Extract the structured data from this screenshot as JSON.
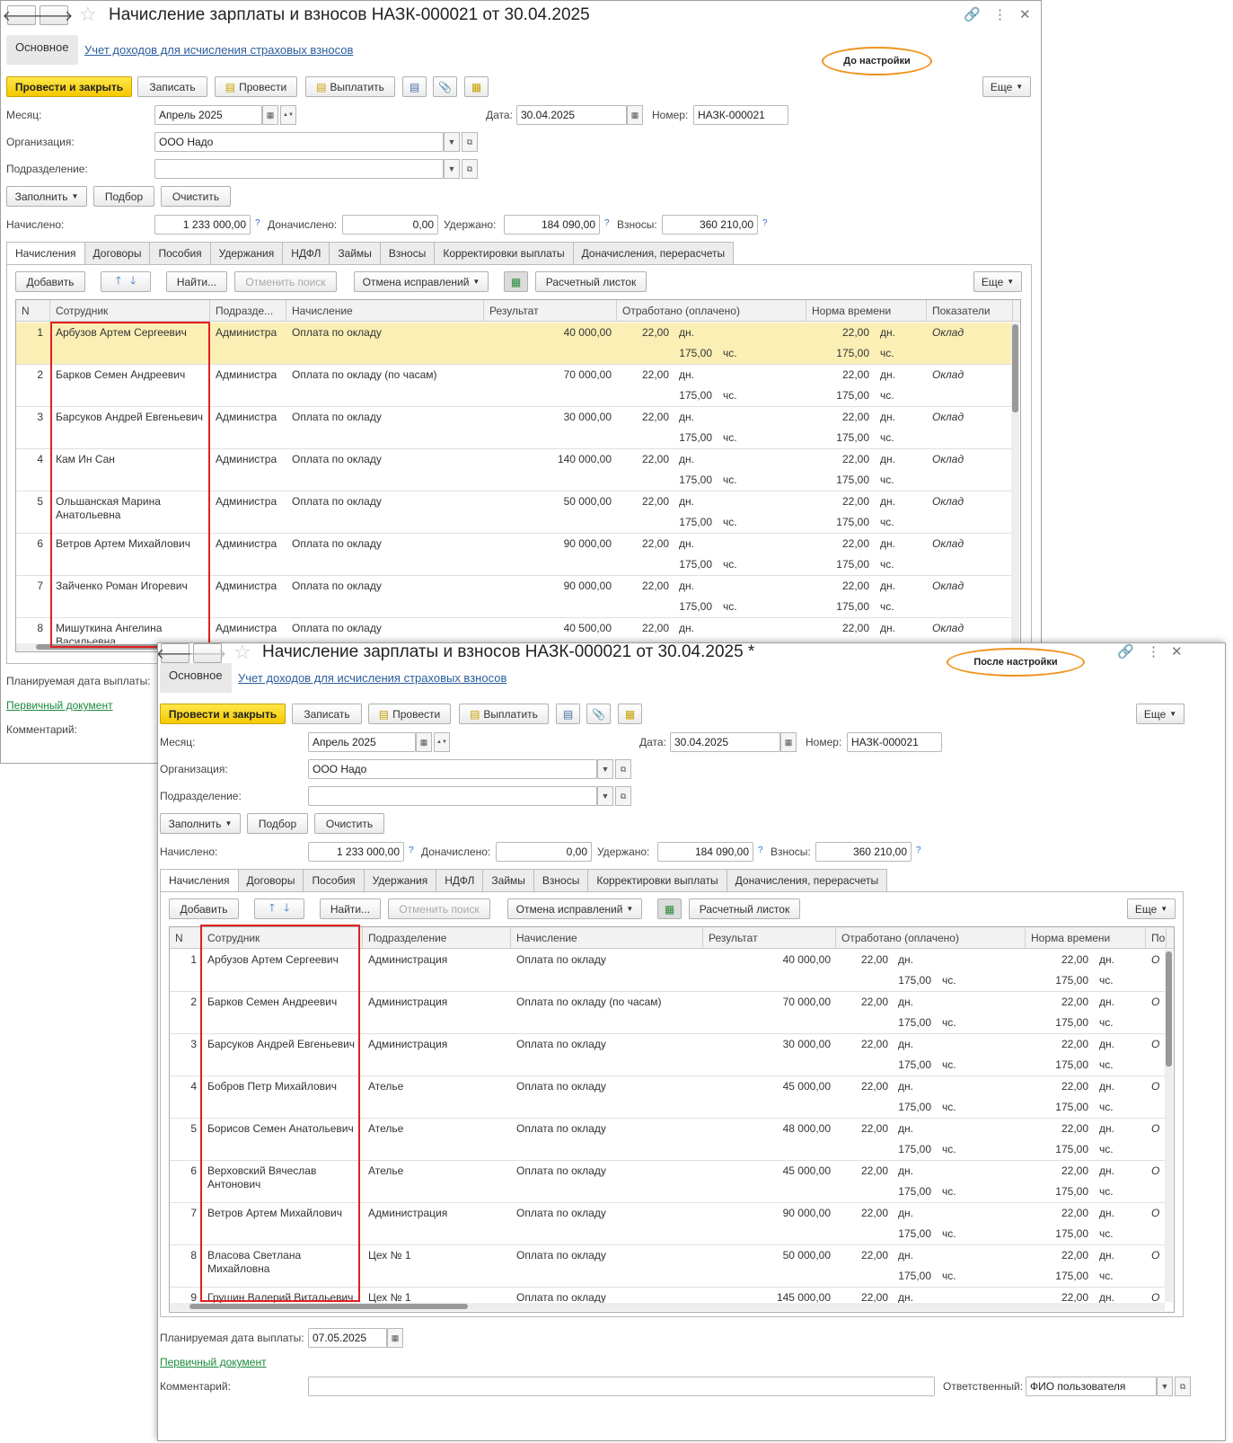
{
  "before": {
    "title": "Начисление зарплаты и взносов НАЗК-000021 от 30.04.2025",
    "nav_back": "🡐",
    "nav_fwd": "🡒",
    "tab_main": "Основное",
    "tab_link": "Учет доходов для исчисления страховых взносов",
    "annotation": "До настройки",
    "toolbar": {
      "post_close": "Провести и закрыть",
      "save": "Записать",
      "post": "Провести",
      "pay": "Выплатить",
      "more": "Еще"
    },
    "month_label": "Месяц:",
    "month_value": "Апрель 2025",
    "date_label": "Дата:",
    "date_value": "30.04.2025",
    "number_label": "Номер:",
    "number_value": "НАЗК-000021",
    "org_label": "Организация:",
    "org_value": "ООО Надо",
    "dept_label": "Подразделение:",
    "dept_value": "",
    "fill": "Заполнить",
    "pick": "Подбор",
    "clear": "Очистить",
    "accrued_label": "Начислено:",
    "accrued_value": "1 233 000,00",
    "extra_label": "Доначислено:",
    "extra_value": "0,00",
    "withheld_label": "Удержано:",
    "withheld_value": "184 090,00",
    "contrib_label": "Взносы:",
    "contrib_value": "360 210,00",
    "q": "?",
    "tabs": [
      "Начисления",
      "Договоры",
      "Пособия",
      "Удержания",
      "НДФЛ",
      "Займы",
      "Взносы",
      "Корректировки выплаты",
      "Доначисления, перерасчеты"
    ],
    "grid_toolbar": {
      "add": "Добавить",
      "find": "Найти...",
      "cancel_find": "Отменить поиск",
      "undo_fix": "Отмена исправлений",
      "payslip": "Расчетный листок",
      "more": "Еще"
    },
    "columns": [
      "N",
      "Сотрудник",
      "Подразде...",
      "Начисление",
      "Результат",
      "Отработано (оплачено)",
      "Норма времени",
      "Показатели"
    ],
    "rows": [
      {
        "n": "1",
        "emp": "Арбузов Артем Сергеевич",
        "dept": "Администра",
        "accr": "Оплата по окладу",
        "res": "40 000,00",
        "d": "22,00",
        "du": "дн.",
        "h": "175,00",
        "hu": "чс.",
        "nd": "22,00",
        "ndu": "дн.",
        "nh": "175,00",
        "nhu": "чс.",
        "ind": "Оклад"
      },
      {
        "n": "2",
        "emp": "Барков Семен Андреевич",
        "dept": "Администра",
        "accr": "Оплата по окладу (по часам)",
        "res": "70 000,00",
        "d": "22,00",
        "du": "дн.",
        "h": "175,00",
        "hu": "чс.",
        "nd": "22,00",
        "ndu": "дн.",
        "nh": "175,00",
        "nhu": "чс.",
        "ind": "Оклад"
      },
      {
        "n": "3",
        "emp": "Барсуков Андрей Евгеньевич",
        "dept": "Администра",
        "accr": "Оплата по окладу",
        "res": "30 000,00",
        "d": "22,00",
        "du": "дн.",
        "h": "175,00",
        "hu": "чс.",
        "nd": "22,00",
        "ndu": "дн.",
        "nh": "175,00",
        "nhu": "чс.",
        "ind": "Оклад"
      },
      {
        "n": "4",
        "emp": "Кам Ин Сан",
        "dept": "Администра",
        "accr": "Оплата по окладу",
        "res": "140 000,00",
        "d": "22,00",
        "du": "дн.",
        "h": "175,00",
        "hu": "чс.",
        "nd": "22,00",
        "ndu": "дн.",
        "nh": "175,00",
        "nhu": "чс.",
        "ind": "Оклад"
      },
      {
        "n": "5",
        "emp": "Ольшанская Марина Анатольевна",
        "dept": "Администра",
        "accr": "Оплата по окладу",
        "res": "50 000,00",
        "d": "22,00",
        "du": "дн.",
        "h": "175,00",
        "hu": "чс.",
        "nd": "22,00",
        "ndu": "дн.",
        "nh": "175,00",
        "nhu": "чс.",
        "ind": "Оклад"
      },
      {
        "n": "6",
        "emp": "Ветров Артем Михайлович",
        "dept": "Администра",
        "accr": "Оплата по окладу",
        "res": "90 000,00",
        "d": "22,00",
        "du": "дн.",
        "h": "175,00",
        "hu": "чс.",
        "nd": "22,00",
        "ndu": "дн.",
        "nh": "175,00",
        "nhu": "чс.",
        "ind": "Оклад"
      },
      {
        "n": "7",
        "emp": "Зайченко Роман Игоревич",
        "dept": "Администра",
        "accr": "Оплата по окладу",
        "res": "90 000,00",
        "d": "22,00",
        "du": "дн.",
        "h": "175,00",
        "hu": "чс.",
        "nd": "22,00",
        "ndu": "дн.",
        "nh": "175,00",
        "nhu": "чс.",
        "ind": "Оклад"
      },
      {
        "n": "8",
        "emp": "Мишуткина Ангелина Васильевна",
        "dept": "Администра",
        "accr": "Оплата по окладу",
        "res": "40 500,00",
        "d": "22,00",
        "du": "дн.",
        "h": "",
        "hu": "",
        "nd": "22,00",
        "ndu": "дн.",
        "nh": "",
        "nhu": "",
        "ind": "Оклад"
      }
    ],
    "planned_label": "Планируемая дата выплаты:",
    "primary_doc": "Первичный документ",
    "comment_label": "Комментарий:"
  },
  "after": {
    "title": "Начисление зарплаты и взносов НАЗК-000021 от 30.04.2025 *",
    "nav_back": "🡐",
    "nav_fwd": "🡒",
    "tab_main": "Основное",
    "tab_link": "Учет доходов для исчисления страховых взносов",
    "annotation": "После настройки",
    "toolbar": {
      "post_close": "Провести и закрыть",
      "save": "Записать",
      "post": "Провести",
      "pay": "Выплатить",
      "more": "Еще"
    },
    "month_label": "Месяц:",
    "month_value": "Апрель 2025",
    "date_label": "Дата:",
    "date_value": "30.04.2025",
    "number_label": "Номер:",
    "number_value": "НАЗК-000021",
    "org_label": "Организация:",
    "org_value": "ООО Надо",
    "dept_label": "Подразделение:",
    "dept_value": "",
    "fill": "Заполнить",
    "pick": "Подбор",
    "clear": "Очистить",
    "accrued_label": "Начислено:",
    "accrued_value": "1 233 000,00",
    "extra_label": "Доначислено:",
    "extra_value": "0,00",
    "withheld_label": "Удержано:",
    "withheld_value": "184 090,00",
    "contrib_label": "Взносы:",
    "contrib_value": "360 210,00",
    "q": "?",
    "tabs": [
      "Начисления",
      "Договоры",
      "Пособия",
      "Удержания",
      "НДФЛ",
      "Займы",
      "Взносы",
      "Корректировки выплаты",
      "Доначисления, перерасчеты"
    ],
    "grid_toolbar": {
      "add": "Добавить",
      "find": "Найти...",
      "cancel_find": "Отменить поиск",
      "undo_fix": "Отмена исправлений",
      "payslip": "Расчетный листок",
      "more": "Еще"
    },
    "columns": [
      "N",
      "Сотрудник",
      "Подразделение",
      "Начисление",
      "Результат",
      "Отработано (оплачено)",
      "Норма времени",
      "По"
    ],
    "rows": [
      {
        "n": "1",
        "emp": "Арбузов Артем Сергеевич",
        "dept": "Администрация",
        "accr": "Оплата по окладу",
        "res": "40 000,00",
        "d": "22,00",
        "du": "дн.",
        "h": "175,00",
        "hu": "чс.",
        "nd": "22,00",
        "ndu": "дн.",
        "nh": "175,00",
        "nhu": "чс.",
        "ind": "О"
      },
      {
        "n": "2",
        "emp": "Барков Семен Андреевич",
        "dept": "Администрация",
        "accr": "Оплата по окладу (по часам)",
        "res": "70 000,00",
        "d": "22,00",
        "du": "дн.",
        "h": "175,00",
        "hu": "чс.",
        "nd": "22,00",
        "ndu": "дн.",
        "nh": "175,00",
        "nhu": "чс.",
        "ind": "О"
      },
      {
        "n": "3",
        "emp": "Барсуков Андрей Евгеньевич",
        "dept": "Администрация",
        "accr": "Оплата по окладу",
        "res": "30 000,00",
        "d": "22,00",
        "du": "дн.",
        "h": "175,00",
        "hu": "чс.",
        "nd": "22,00",
        "ndu": "дн.",
        "nh": "175,00",
        "nhu": "чс.",
        "ind": "О"
      },
      {
        "n": "4",
        "emp": "Бобров Петр Михайлович",
        "dept": "Ателье",
        "accr": "Оплата по окладу",
        "res": "45 000,00",
        "d": "22,00",
        "du": "дн.",
        "h": "175,00",
        "hu": "чс.",
        "nd": "22,00",
        "ndu": "дн.",
        "nh": "175,00",
        "nhu": "чс.",
        "ind": "О"
      },
      {
        "n": "5",
        "emp": "Борисов Семен Анатольевич",
        "dept": "Ателье",
        "accr": "Оплата по окладу",
        "res": "48 000,00",
        "d": "22,00",
        "du": "дн.",
        "h": "175,00",
        "hu": "чс.",
        "nd": "22,00",
        "ndu": "дн.",
        "nh": "175,00",
        "nhu": "чс.",
        "ind": "О"
      },
      {
        "n": "6",
        "emp": "Верховский Вячеслав Антонович",
        "dept": "Ателье",
        "accr": "Оплата по окладу",
        "res": "45 000,00",
        "d": "22,00",
        "du": "дн.",
        "h": "175,00",
        "hu": "чс.",
        "nd": "22,00",
        "ndu": "дн.",
        "nh": "175,00",
        "nhu": "чс.",
        "ind": "О"
      },
      {
        "n": "7",
        "emp": "Ветров Артем Михайлович",
        "dept": "Администрация",
        "accr": "Оплата по окладу",
        "res": "90 000,00",
        "d": "22,00",
        "du": "дн.",
        "h": "175,00",
        "hu": "чс.",
        "nd": "22,00",
        "ndu": "дн.",
        "nh": "175,00",
        "nhu": "чс.",
        "ind": "О"
      },
      {
        "n": "8",
        "emp": "Власова Светлана Михайловна",
        "dept": "Цех № 1",
        "accr": "Оплата по окладу",
        "res": "50 000,00",
        "d": "22,00",
        "du": "дн.",
        "h": "175,00",
        "hu": "чс.",
        "nd": "22,00",
        "ndu": "дн.",
        "nh": "175,00",
        "nhu": "чс.",
        "ind": "О"
      },
      {
        "n": "9",
        "emp": "Грушин Валерий Витальевич",
        "dept": "Цех № 1",
        "accr": "Оплата по окладу",
        "res": "145 000,00",
        "d": "22,00",
        "du": "дн.",
        "h": "",
        "hu": "",
        "nd": "22,00",
        "ndu": "дн.",
        "nh": "",
        "nhu": "",
        "ind": "О"
      }
    ],
    "planned_label": "Планируемая дата выплаты:",
    "planned_value": "07.05.2025",
    "primary_doc": "Первичный документ",
    "comment_label": "Комментарий:",
    "comment_value": "",
    "responsible_label": "Ответственный:",
    "responsible_value": "ФИО пользователя"
  },
  "colors": {
    "accent_yellow": "#f5c800",
    "selected_row": "#fbefb5",
    "red_frame": "#e02020",
    "oval": "#f0921c",
    "link": "#2a5d9c",
    "green_link": "#1a8a3a"
  }
}
